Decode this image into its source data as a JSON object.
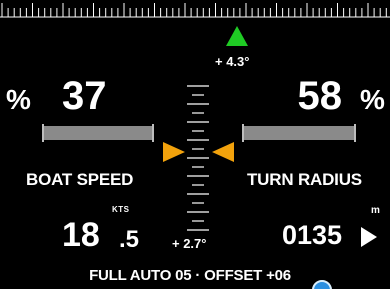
{
  "heading_ruler": {
    "icon": "heading-ruler"
  },
  "left_panel": {
    "percent_symbol": "%",
    "speed_percent": "37",
    "bar_fill_fraction": 1.0,
    "label": "BOAT SPEED",
    "unit": "KTS",
    "value_int": "18",
    "value_dec": ".5"
  },
  "right_panel": {
    "percent_symbol": "%",
    "radius_percent": "58",
    "bar_fill_fraction": 1.0,
    "label": "TURN RADIUS",
    "unit": "m",
    "value": "0135"
  },
  "center": {
    "top_angle": "+ 4.3°",
    "bottom_angle": "+ 2.7°"
  },
  "status": {
    "text": "FULL AUTO 05 · OFFSET +06"
  },
  "colors": {
    "background": "#000000",
    "pointer": "#f2a20c",
    "indicator": "#1fcb24",
    "bar": "#8a8a8a",
    "touch_dot": "#2b8fe0"
  }
}
